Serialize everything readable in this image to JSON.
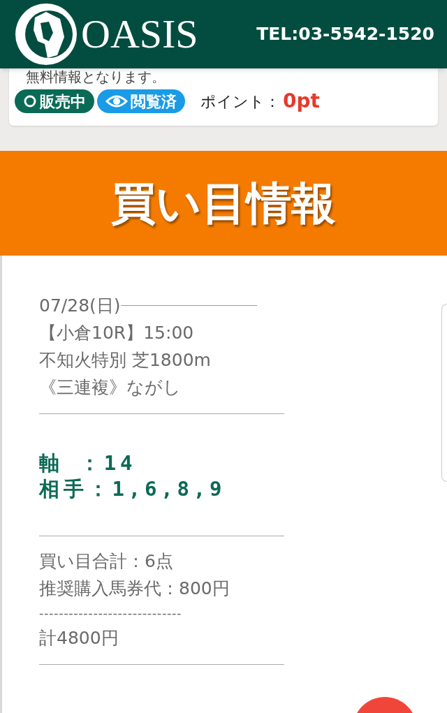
{
  "header": {
    "logo_text": "OASIS",
    "phone": "TEL:03-5542-1520"
  },
  "info_card": {
    "note": "無料情報となります。",
    "badges": [
      {
        "kind": "status",
        "label": "販売中"
      },
      {
        "kind": "viewed",
        "label": "閲覧済"
      }
    ],
    "points_label": "ポイント：",
    "points_value": "0pt"
  },
  "banner": {
    "title": "買い目情報"
  },
  "race": {
    "date": "07/28(日)",
    "lines": [
      "【小倉10R】15:00",
      "不知火特別 芝1800m",
      "《三連複》ながし"
    ]
  },
  "picks": [
    "軸 ：14",
    "相手：1,6,8,9"
  ],
  "summary": {
    "lines": [
      "買い目合計：6点",
      "推奨購入馬券代：800円"
    ],
    "separator": "-----------------------------",
    "total": "計4800円"
  }
}
